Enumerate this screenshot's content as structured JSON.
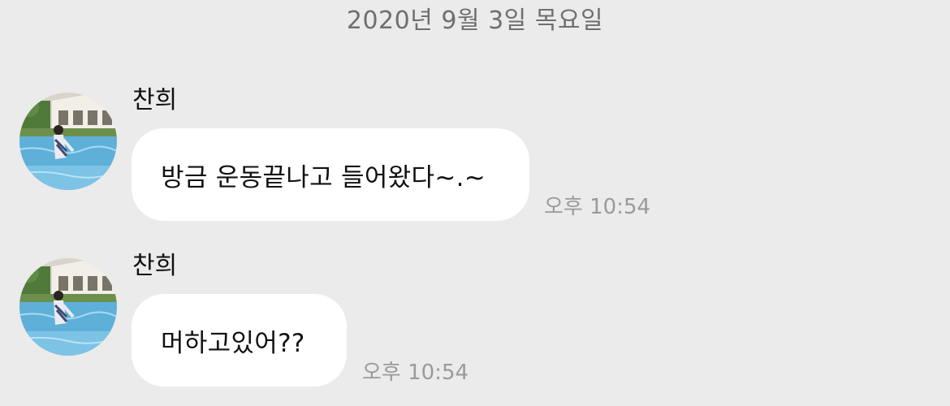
{
  "chat": {
    "date_divider": "2020년 9월 3일 목요일",
    "messages": [
      {
        "sender": "찬희",
        "avatar_icon": "profile-photo-pool",
        "text": "방금 운동끝나고 들어왔다~.~",
        "time": "오후 10:54"
      },
      {
        "sender": "찬희",
        "avatar_icon": "profile-photo-pool",
        "text": "머하고있어??",
        "time": "오후 10:54"
      }
    ]
  },
  "colors": {
    "background": "#ebebeb",
    "bubble": "#ffffff",
    "timestamp": "#9a9a9a",
    "date_text": "#6f6f6f"
  }
}
